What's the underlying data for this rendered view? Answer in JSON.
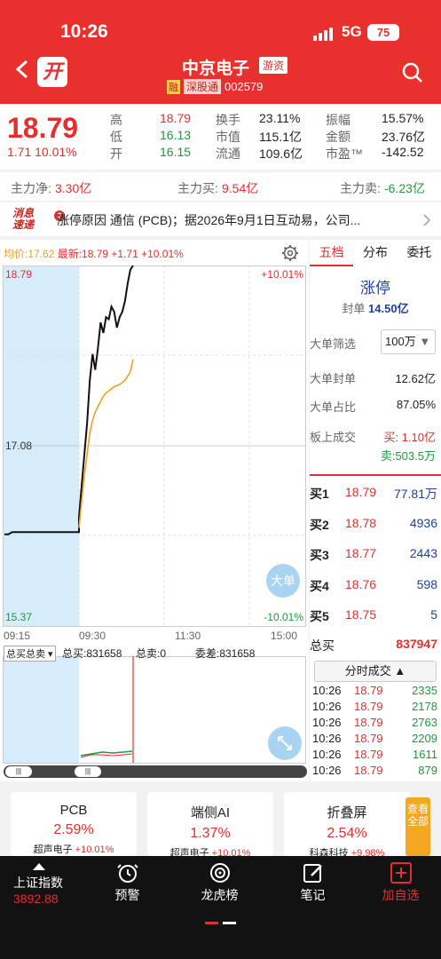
{
  "status": {
    "time": "10:26",
    "network": "5G",
    "battery": "75"
  },
  "header": {
    "title": "中京电子",
    "tag": "游资",
    "margin_tag": "融",
    "connect_tag": "深股通",
    "code": "002579",
    "logo": "开"
  },
  "quote": {
    "price": "18.79",
    "change": "1.71 10.01%",
    "cells": [
      {
        "label": "高",
        "value": "18.79",
        "color": "red"
      },
      {
        "label": "换手",
        "value": "23.11%"
      },
      {
        "label": "振幅",
        "value": "15.57%"
      },
      {
        "label": "低",
        "value": "16.13",
        "color": "green"
      },
      {
        "label": "市值",
        "value": "115.1亿"
      },
      {
        "label": "金额",
        "value": "23.76亿"
      },
      {
        "label": "开",
        "value": "16.15",
        "color": "green"
      },
      {
        "label": "流通",
        "value": "109.6亿"
      },
      {
        "label": "市盈™",
        "value": "-142.52"
      }
    ]
  },
  "flow": {
    "net_label": "主力净:",
    "net": "3.30亿",
    "buy_label": "主力买:",
    "buy": "9.54亿",
    "sell_label": "主力卖:",
    "sell": "-6.23亿"
  },
  "news": {
    "logo_line1": "消息",
    "logo_line2": "速递",
    "badge": "2",
    "text": "涨停原因   通信 (PCB)；据2026年9月1日互动易，公司..."
  },
  "chart": {
    "avg_label": "均价:17.62",
    "latest_label": "最新:18.79 +1.71 +10.01%",
    "y_top": "18.79",
    "y_mid": "17.08",
    "y_bot": "15.37",
    "pct_top": "+10.01%",
    "pct_bot": "-10.01%",
    "x_labels": [
      "09:15",
      "09:30",
      "11:30",
      "15:00"
    ],
    "big_order_btn": "大单",
    "vol_select": "总买总卖",
    "total_buy": "总买:831658",
    "total_sell": "总卖:0",
    "weicha": "委差:831658"
  },
  "chart_data": {
    "type": "line",
    "ylim": [
      15.37,
      18.79
    ],
    "series": [
      {
        "color": "#111111",
        "values": [
          16.24,
          16.24,
          16.26,
          16.26,
          16.26,
          16.26,
          16.26,
          16.26,
          16.26,
          16.26,
          16.26,
          16.26,
          16.26,
          16.26,
          16.26,
          16.26,
          16.26,
          16.26,
          16.26,
          16.26,
          16.4,
          16.7,
          17.0,
          17.3,
          17.7,
          17.95,
          17.8,
          18.0,
          18.25,
          18.15,
          18.3,
          18.28,
          18.4,
          18.35,
          18.2,
          18.3,
          18.35,
          18.45,
          18.62,
          18.75,
          18.79
        ]
      },
      {
        "color": "#f0a020",
        "values": [
          null,
          null,
          null,
          null,
          null,
          null,
          null,
          null,
          null,
          null,
          null,
          null,
          null,
          null,
          null,
          null,
          null,
          null,
          null,
          null,
          16.3,
          16.55,
          16.8,
          17.0,
          17.2,
          17.32,
          17.4,
          17.45,
          17.5,
          17.55,
          17.58,
          17.6,
          17.62,
          17.64,
          17.65,
          17.66,
          17.68,
          17.7,
          17.74,
          17.78,
          17.9
        ]
      }
    ]
  },
  "book": {
    "tabs": [
      "五档",
      "分布",
      "委托"
    ],
    "limit_up": "涨停",
    "seal_label": "封单",
    "seal_value": "14.50亿",
    "filter_label": "大单筛选",
    "filter_value": "100万",
    "big_seal_label": "大单封单",
    "big_seal_value": "12.62亿",
    "big_ratio_label": "大单占比",
    "big_ratio_value": "87.05%",
    "board_label": "板上成交",
    "board_buy": "买: 1.10亿",
    "board_sell": "卖:503.5万",
    "bids": [
      {
        "label": "买1",
        "price": "18.79",
        "vol": "77.81万"
      },
      {
        "label": "买2",
        "price": "18.78",
        "vol": "4936"
      },
      {
        "label": "买3",
        "price": "18.77",
        "vol": "2443"
      },
      {
        "label": "买4",
        "price": "18.76",
        "vol": "598"
      },
      {
        "label": "买5",
        "price": "18.75",
        "vol": "5"
      }
    ],
    "total_label": "总买",
    "total_value": "837947",
    "trades_btn": "分时成交",
    "trades": [
      {
        "time": "10:26",
        "price": "18.79",
        "vol": "2335"
      },
      {
        "time": "10:26",
        "price": "18.79",
        "vol": "2178"
      },
      {
        "time": "10:26",
        "price": "18.79",
        "vol": "2763"
      },
      {
        "time": "10:26",
        "price": "18.79",
        "vol": "2209"
      },
      {
        "time": "10:26",
        "price": "18.79",
        "vol": "1611"
      },
      {
        "time": "10:26",
        "price": "18.79",
        "vol": "879"
      }
    ]
  },
  "sectors": [
    {
      "name": "PCB",
      "pct": "2.59%",
      "lead": "超声电子",
      "lead_pct": "+10.01%"
    },
    {
      "name": "端侧AI",
      "pct": "1.37%",
      "lead": "超声电子",
      "lead_pct": "+10.01%"
    },
    {
      "name": "折叠屏",
      "pct": "2.54%",
      "lead": "科森科技",
      "lead_pct": "+9.98%"
    }
  ],
  "view_all": "查看全部",
  "bottom": {
    "index_name": "上证指数",
    "index_value": "3892.88",
    "items": [
      "预警",
      "龙虎榜",
      "笔记",
      "加自选"
    ]
  }
}
